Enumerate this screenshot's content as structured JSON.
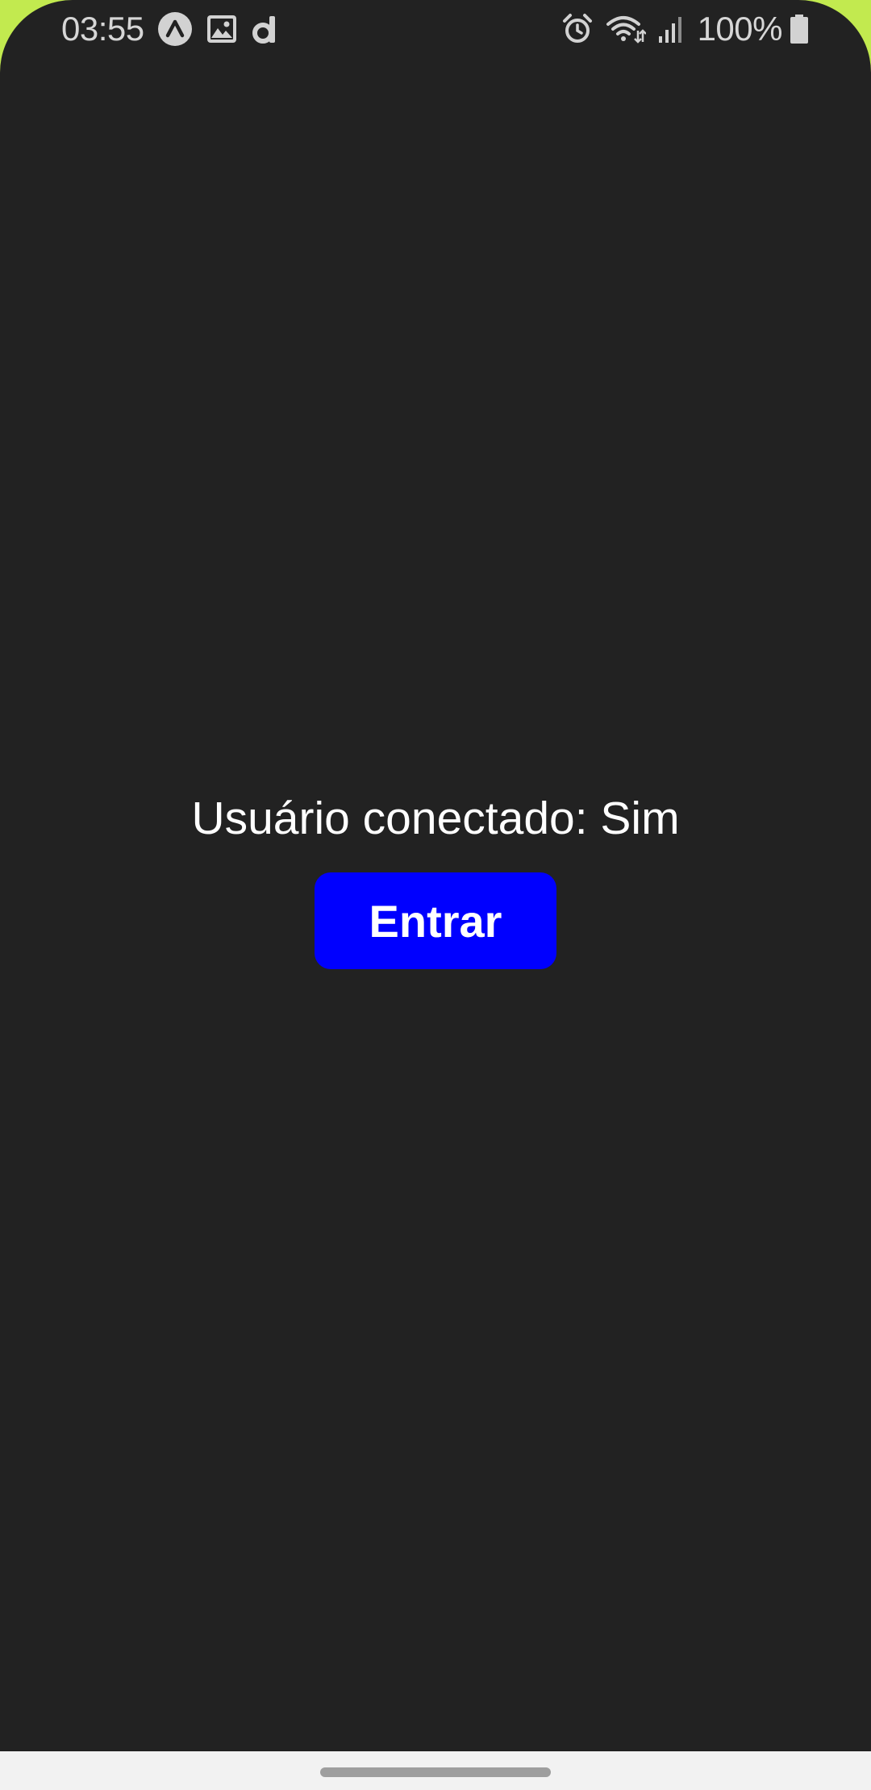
{
  "status_bar": {
    "time": "03:55",
    "battery_level": "100%",
    "notification_icons": [
      "expo-icon",
      "image-icon",
      "d-app-icon"
    ],
    "system_icons": [
      "alarm-icon",
      "wifi-icon",
      "signal-icon",
      "battery-icon"
    ]
  },
  "main": {
    "status_text": "Usuário conectado: Sim",
    "button_label": "Entrar",
    "button_color": "#0000ff",
    "text_color": "#ffffff",
    "background_color": "#222222"
  },
  "system": {
    "wallpaper_color": "#c2ea4f",
    "nav_bar_color": "#f2f2f2"
  }
}
